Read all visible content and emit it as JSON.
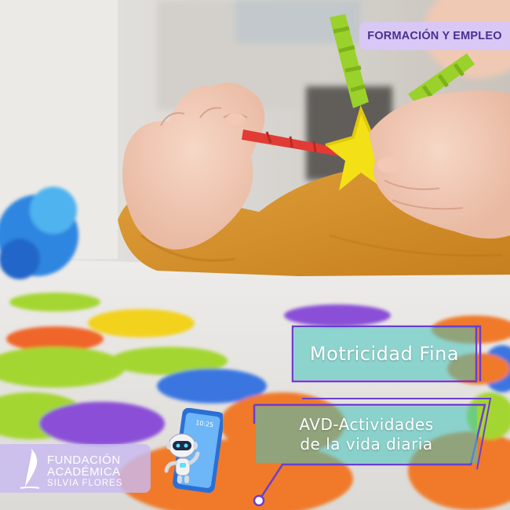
{
  "badge": {
    "label": "FORMACIÓN Y EMPLEO"
  },
  "panels": {
    "primary": "Motricidad Fina",
    "secondary_line1": "AVD-Actividades",
    "secondary_line2": "de la vida diaria"
  },
  "logo": {
    "line1": "FUNDACIÓN",
    "line2": "ACADÉMICA",
    "line3": "SILVIA FLORES"
  },
  "phone": {
    "time": "10:25"
  },
  "colors": {
    "badge_bg": "#d9c8f5",
    "badge_text": "#4b2f8f",
    "panel_bg": "#44c4be",
    "frame_line": "#6a3fd0",
    "sweater": "#d9952a"
  }
}
